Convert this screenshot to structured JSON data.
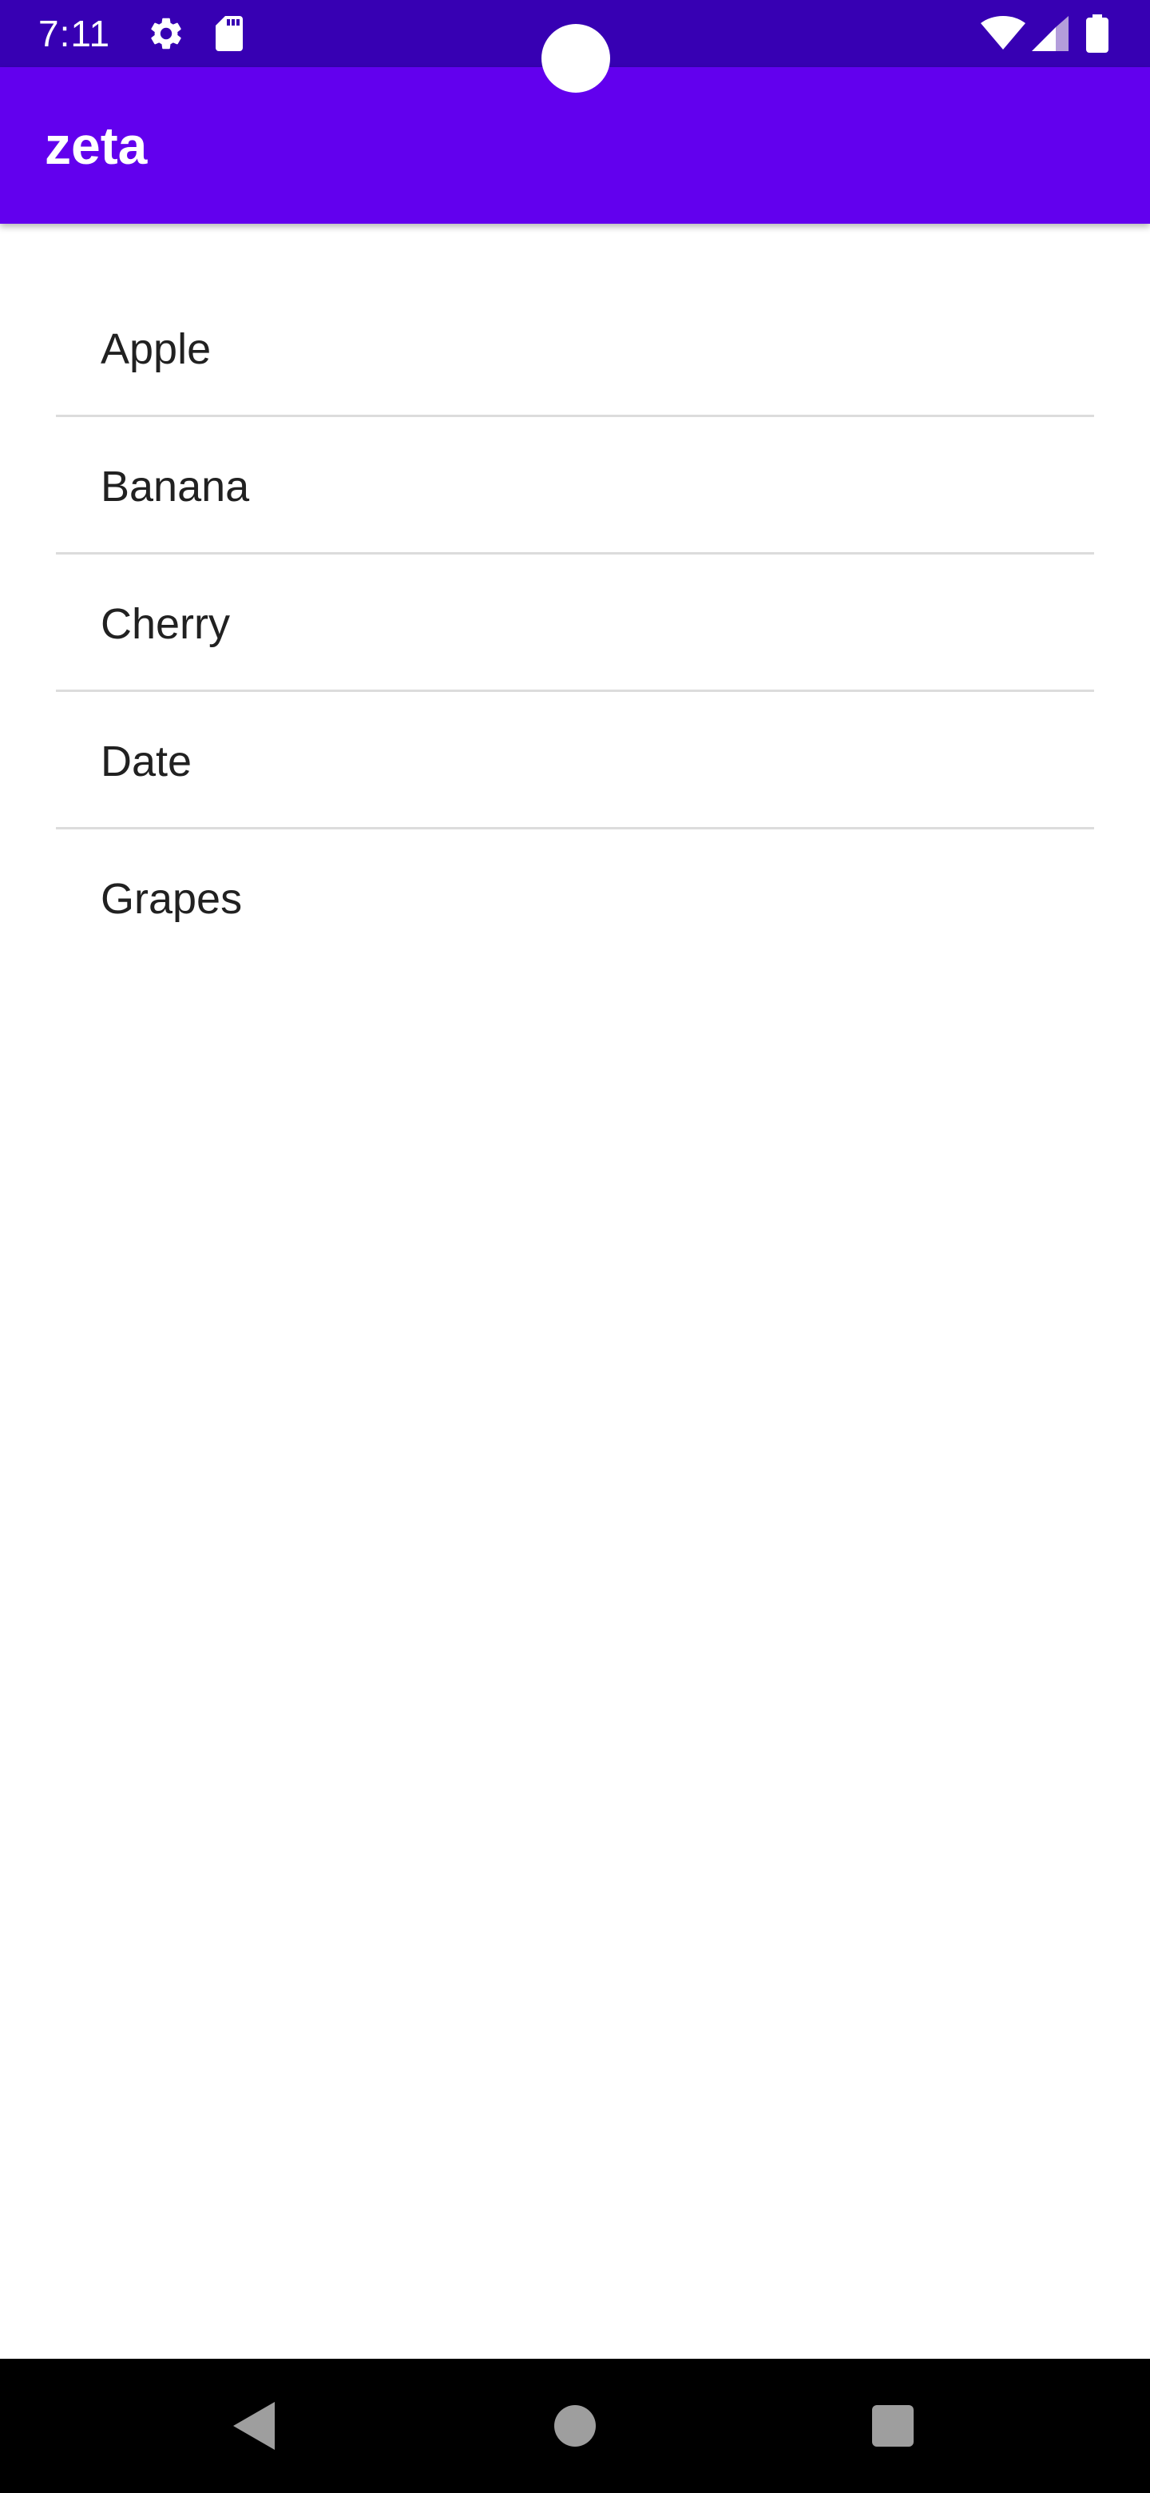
{
  "status_bar": {
    "time": "7:11",
    "left_icons": [
      "gear-icon",
      "sd-card-icon"
    ],
    "right_icons": [
      "wifi-icon",
      "signal-icon",
      "battery-icon"
    ],
    "background_color": "#3700b3"
  },
  "app_bar": {
    "title": "zeta",
    "background_color": "#6200ee"
  },
  "list": {
    "items": [
      {
        "label": "Apple"
      },
      {
        "label": "Banana"
      },
      {
        "label": "Cherry"
      },
      {
        "label": "Date"
      },
      {
        "label": "Grapes"
      }
    ]
  },
  "navigation_bar": {
    "buttons": [
      "back-icon",
      "home-icon",
      "recents-icon"
    ],
    "background_color": "#000000"
  }
}
